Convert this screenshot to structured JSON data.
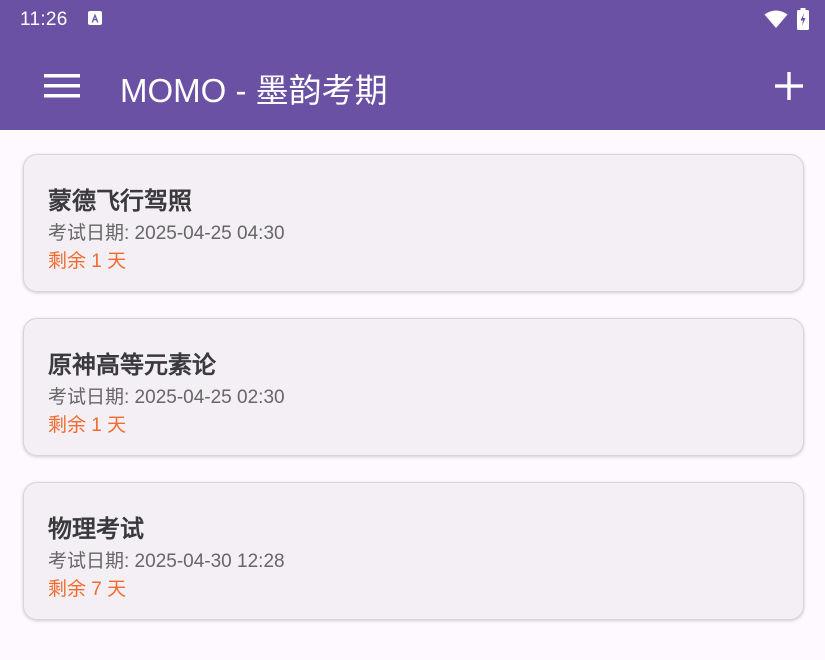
{
  "status_bar": {
    "time": "11:26",
    "notification_icon": "a-letter-icon",
    "wifi_icon": "wifi-icon",
    "battery_icon": "battery-charging-icon"
  },
  "app_bar": {
    "title": "MOMO - 墨韵考期",
    "menu_icon": "hamburger-menu-icon",
    "add_icon": "plus-icon",
    "background_color": "#6a51a3"
  },
  "exams": [
    {
      "title": "蒙德飞行驾照",
      "date": "考试日期: 2025-04-25 04:30",
      "remaining": "剩余 1 天"
    },
    {
      "title": "原神高等元素论",
      "date": "考试日期: 2025-04-25 02:30",
      "remaining": "剩余 1 天"
    },
    {
      "title": "物理考试",
      "date": "考试日期: 2025-04-30 12:28",
      "remaining": "剩余 7 天"
    }
  ],
  "colors": {
    "accent": "#6a51a3",
    "remaining_text": "#f26b2e",
    "card_background": "#f3eff4"
  }
}
